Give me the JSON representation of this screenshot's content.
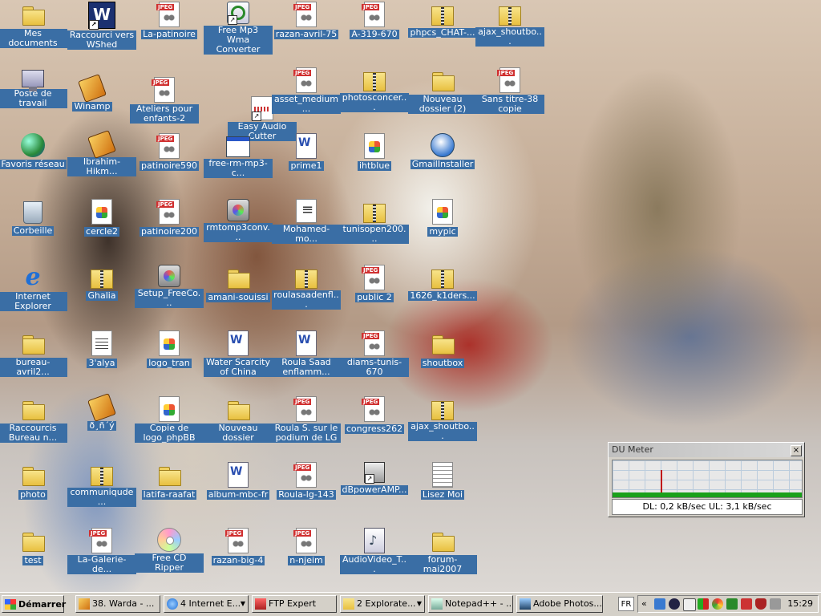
{
  "desktop": {
    "icons": [
      {
        "label": "Mes documents",
        "type": "folder"
      },
      {
        "label": "Raccourci vers WShed",
        "type": "wshed"
      },
      {
        "label": "La-patinoire",
        "type": "jpeg"
      },
      {
        "label": "Free Mp3 Wma Converter",
        "type": "mp3"
      },
      {
        "label": "razan-avril-75",
        "type": "jpeg"
      },
      {
        "label": "A-319-670",
        "type": "jpeg"
      },
      {
        "label": "phpcs_CHAT-...",
        "type": "zip"
      },
      {
        "label": "ajax_shoutbo...",
        "type": "zip"
      },
      {
        "label": "Poste de travail",
        "type": "pc"
      },
      {
        "label": "Winamp",
        "type": "winamp"
      },
      {
        "label": "Ateliers pour enfants-2",
        "type": "jpeg"
      },
      {
        "label": "Easy Audio Cutter",
        "type": "audio"
      },
      {
        "label": "asset_medium...",
        "type": "jpeg"
      },
      {
        "label": "photosconcer...",
        "type": "zip"
      },
      {
        "label": "Nouveau dossier (2)",
        "type": "folder"
      },
      {
        "label": "Sans titre-38 copie",
        "type": "jpeg"
      },
      {
        "label": "Favoris réseau",
        "type": "globe"
      },
      {
        "label": "Ibrahim-Hikm...",
        "type": "winamp"
      },
      {
        "label": "patinoire590",
        "type": "jpeg"
      },
      {
        "label": "free-rm-mp3-c...",
        "type": "window"
      },
      {
        "label": "prime1",
        "type": "word"
      },
      {
        "label": "ihtblue",
        "type": "img"
      },
      {
        "label": "GmailInstaller",
        "type": "gmail"
      },
      {
        "label": "Corbeille",
        "type": "bin"
      },
      {
        "label": "cercle2",
        "type": "img"
      },
      {
        "label": "patinoire200",
        "type": "jpeg"
      },
      {
        "label": "rmtomp3conv...",
        "type": "setup"
      },
      {
        "label": "Mohamed-mo...",
        "type": "doc-ic"
      },
      {
        "label": "tunisopen200...",
        "type": "zip"
      },
      {
        "label": "mypic",
        "type": "img"
      },
      {
        "label": "Internet Explorer",
        "type": "ie"
      },
      {
        "label": "Ghalia",
        "type": "zip"
      },
      {
        "label": "Setup_FreeCo...",
        "type": "setup"
      },
      {
        "label": "amani-souissi",
        "type": "folder"
      },
      {
        "label": "roulasaadenfl...",
        "type": "zip"
      },
      {
        "label": "public 2",
        "type": "jpeg"
      },
      {
        "label": "1626_k1ders...",
        "type": "zip"
      },
      {
        "label": "bureau-avril2...",
        "type": "folder"
      },
      {
        "label": "3'alya",
        "type": "txt"
      },
      {
        "label": "logo_tran",
        "type": "img"
      },
      {
        "label": "Water Scarcity of China",
        "type": "word"
      },
      {
        "label": "Roula Saad enflamm...",
        "type": "word"
      },
      {
        "label": "diams-tunis-670",
        "type": "jpeg"
      },
      {
        "label": "shoutbox",
        "type": "folder"
      },
      {
        "label": "Raccourcis Bureau n...",
        "type": "folder"
      },
      {
        "label": "ð¸ñ´ý",
        "type": "winamp"
      },
      {
        "label": "Copie de logo_phpBB",
        "type": "img"
      },
      {
        "label": "Nouveau dossier",
        "type": "folder"
      },
      {
        "label": "Roula S. sur le podium de LG",
        "type": "jpeg"
      },
      {
        "label": "congress262",
        "type": "jpeg"
      },
      {
        "label": "ajax_shoutbo...",
        "type": "zip"
      },
      {
        "label": "photo",
        "type": "folder"
      },
      {
        "label": "communiqude...",
        "type": "zip"
      },
      {
        "label": "latifa-raafat",
        "type": "folder"
      },
      {
        "label": "album-mbc-fr",
        "type": "word"
      },
      {
        "label": "Roula-lg-143",
        "type": "jpeg"
      },
      {
        "label": "dBpowerAMP...",
        "type": "dbpower"
      },
      {
        "label": "Lisez Moi",
        "type": "doc"
      },
      {
        "label": "test",
        "type": "folder"
      },
      {
        "label": "La-Galerie-de...",
        "type": "jpeg"
      },
      {
        "label": "Free CD Ripper",
        "type": "cd"
      },
      {
        "label": "razan-big-4",
        "type": "jpeg"
      },
      {
        "label": "n-njeim",
        "type": "jpeg"
      },
      {
        "label": "AudioVideo_T...",
        "type": "music"
      },
      {
        "label": "forum-mai2007",
        "type": "folder"
      }
    ]
  },
  "dumeter": {
    "title": "DU Meter",
    "close": "×",
    "stats": "DL: 0,2 kB/sec  UL: 3,1 kB/sec"
  },
  "taskbar": {
    "start": "Démarrer",
    "tasks": [
      {
        "label": "38. Warda - ...",
        "icon": "winamp-icon"
      },
      {
        "label": "4 Internet E...",
        "icon": "ie-icon"
      },
      {
        "label": "FTP Expert",
        "icon": "ftp-icon"
      },
      {
        "label": "2 Explorate...",
        "icon": "folder-icon"
      },
      {
        "label": "Notepad++ - ...",
        "icon": "notepad-icon"
      },
      {
        "label": "Adobe Photos...",
        "icon": "photoshop-icon"
      }
    ],
    "language": "FR",
    "tray_arrow": "«",
    "clock": "15:29"
  }
}
